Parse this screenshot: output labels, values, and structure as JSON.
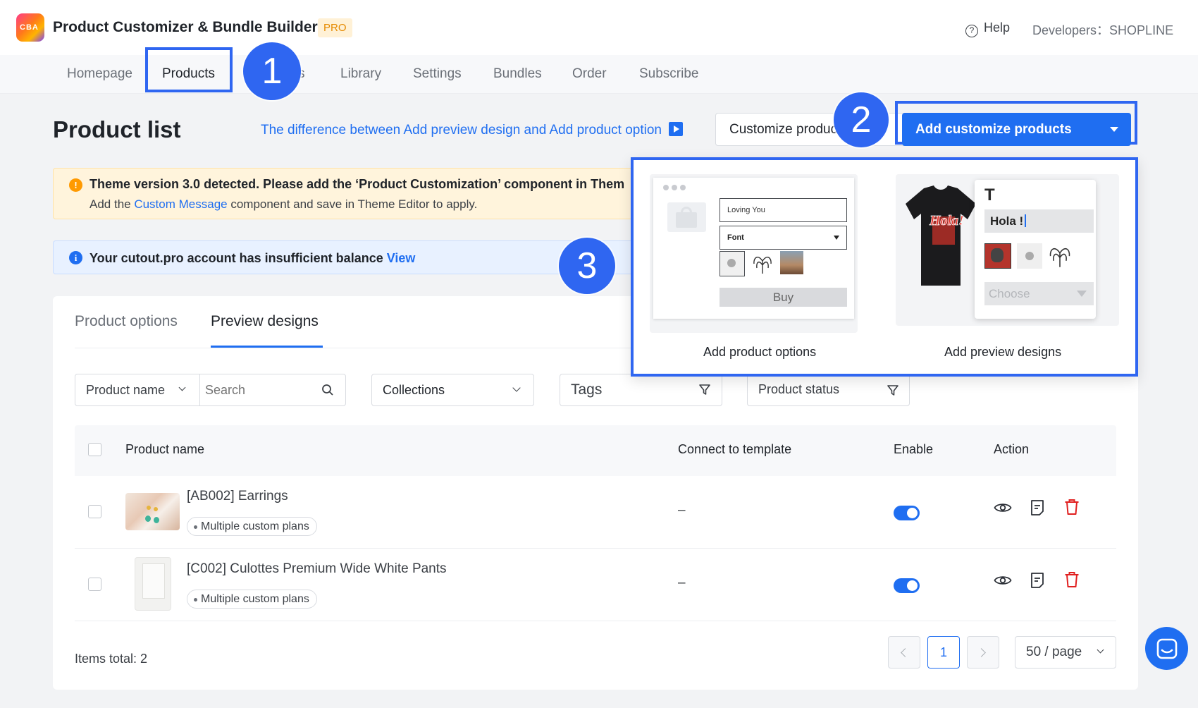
{
  "header": {
    "app_title": "Product Customizer & Bundle Builder",
    "badge": "PRO",
    "help": "Help",
    "developers": "Developers：SHOPLINE"
  },
  "nav": {
    "items": [
      "Homepage",
      "Products",
      "s",
      "Library",
      "Settings",
      "Bundles",
      "Order",
      "Subscribe"
    ],
    "active": "Products"
  },
  "steps": [
    "1",
    "2",
    "3"
  ],
  "main": {
    "title": "Product list",
    "diff_link": "The difference between Add preview design and Add product option",
    "customize_bulk_button": "Customize products in b",
    "add_button": "Add customize products"
  },
  "alerts": {
    "warning_line1": "Theme version 3.0 detected. Please add the ‘Product Customization’ component in Them",
    "warning_line2_pre": "Add the ",
    "warning_line2_link": "Custom Message",
    "warning_line2_post": " component and save in Theme Editor to apply.",
    "info_text": "Your cutout.pro account has insufficient balance",
    "info_link": "View"
  },
  "tabs": [
    "Product options",
    "Preview designs"
  ],
  "filters": {
    "product_name": "Product name",
    "search_placeholder": "Search",
    "collections": "Collections",
    "tags": "Tags",
    "status": "Product status"
  },
  "table": {
    "headers": [
      "Product name",
      "Connect to template",
      "Enable",
      "Action"
    ],
    "rows": [
      {
        "name": "[AB002] Earrings",
        "tag": "Multiple custom plans",
        "template": "–",
        "enabled": true
      },
      {
        "name": "[C002] Culottes Premium Wide White Pants",
        "tag": "Multiple custom plans",
        "template": "–",
        "enabled": true
      }
    ]
  },
  "footer": {
    "items_total": "Items total: 2",
    "current_page": "1",
    "page_size": "50 / page"
  },
  "dropdown": {
    "option1_label": "Add product options",
    "option2_label": "Add preview designs",
    "mock_input1": "Loving You",
    "mock_input2": "Font",
    "mock_buy": "Buy",
    "mock_text_glyph": "T",
    "mock_text_value": "Hola !",
    "mock_choose": "Choose",
    "tshirt_text": "Hola!"
  },
  "colors": {
    "accent": "#1f6ef1",
    "highlight": "#2f66f1",
    "warning_bg": "#fff4dc",
    "info_bg": "#e8f1ff",
    "danger": "#e02020"
  }
}
